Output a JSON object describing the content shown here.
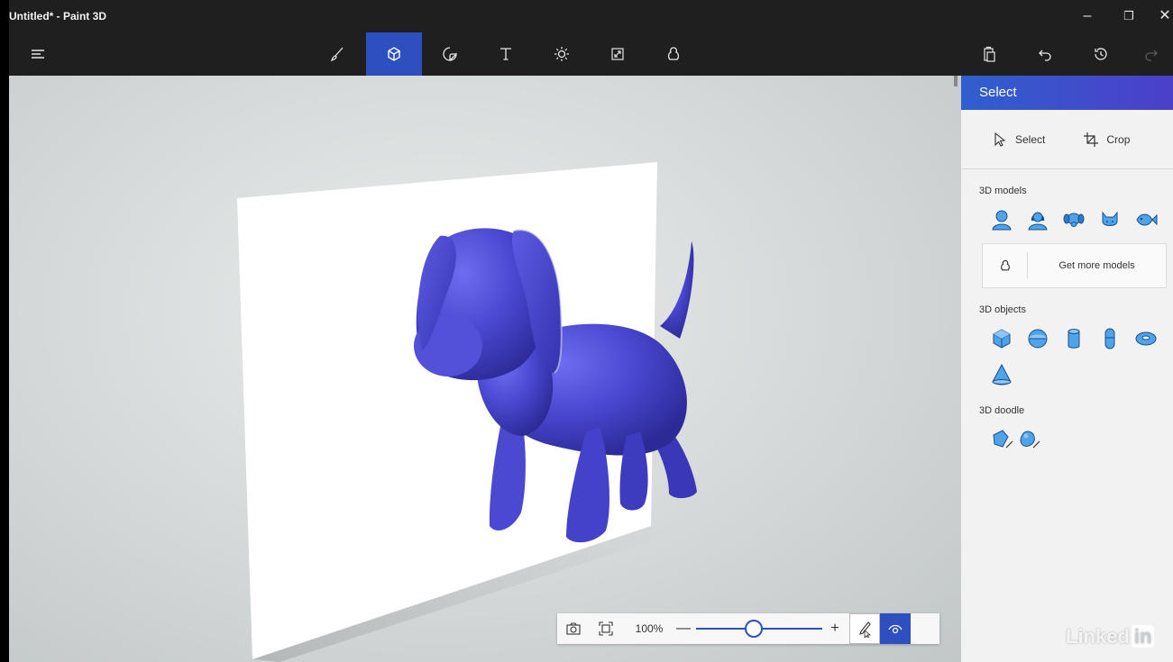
{
  "window": {
    "title": "Untitled* - Paint 3D",
    "minimize": "–",
    "restore": "❐",
    "close": "✕"
  },
  "toolbar": {
    "menu_icon": "hamburger-menu-icon",
    "tools": [
      "brushes-icon",
      "3d-shapes-icon",
      "stickers-icon",
      "text-icon",
      "effects-icon",
      "canvas-icon",
      "remix3d-icon"
    ],
    "active_tool": "3d-shapes-icon",
    "right": [
      "paste-icon",
      "undo-icon",
      "history-icon",
      "redo-icon"
    ],
    "accent": "#2e4fbf"
  },
  "panel": {
    "header": "Select",
    "select_label": "Select",
    "crop_label": "Crop",
    "models_label": "3D models",
    "models": [
      "man-model-icon",
      "woman-model-icon",
      "dog-model-icon",
      "cat-model-icon",
      "fish-model-icon"
    ],
    "get_more_label": "Get more models",
    "objects_label": "3D objects",
    "objects": [
      "cube-icon",
      "sphere-icon",
      "cylinder-icon",
      "capsule-icon",
      "torus-icon",
      "cone-icon"
    ],
    "doodle_label": "3D doodle",
    "doodles": [
      "sharp-edge-doodle-icon",
      "soft-edge-doodle-icon"
    ]
  },
  "zoombar": {
    "zoom_value": "100%",
    "zoom_level": 0.45,
    "minus": "—",
    "plus": "+"
  },
  "canvas": {
    "model": "dog",
    "model_color": "#4d4bd4"
  },
  "watermark": {
    "text": "Linked",
    "suffix": "in"
  }
}
